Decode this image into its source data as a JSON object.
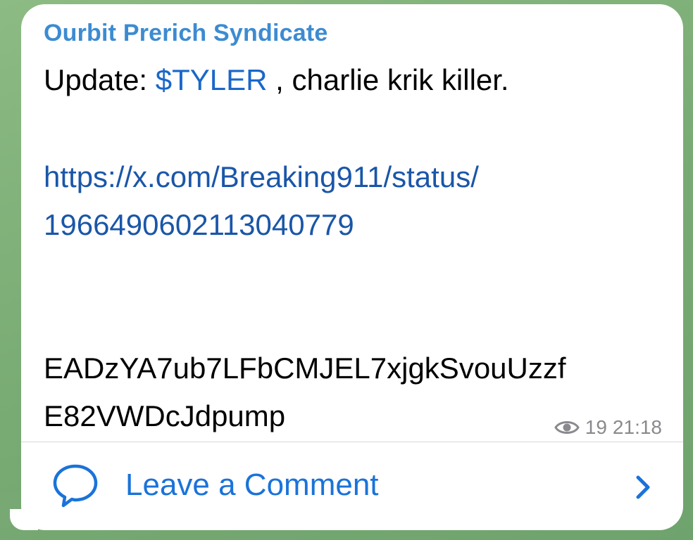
{
  "message": {
    "sender": "Ourbit Prerich Syndicate",
    "line1_prefix": "Update: ",
    "cashtag": "$TYLER",
    "line1_suffix": " , charlie krik killer.",
    "link_part1": "https://x.com/Breaking911/status/",
    "link_part2": "1966490602113040779",
    "address_part1": "EADzYA7ub7LFbCMJEL7xjgkSvouUzzf",
    "address_part2": "E82VWDcJdpump",
    "views": "19",
    "time": "21:18"
  },
  "comments": {
    "label": "Leave a Comment"
  },
  "colors": {
    "sender": "#3d8bd1",
    "link": "#1a56a8",
    "accent": "#1a73d9",
    "meta": "#8a8a8e"
  },
  "icons": {
    "views": "eye-icon",
    "comment": "speech-bubble-icon",
    "chevron": "chevron-right-icon"
  }
}
